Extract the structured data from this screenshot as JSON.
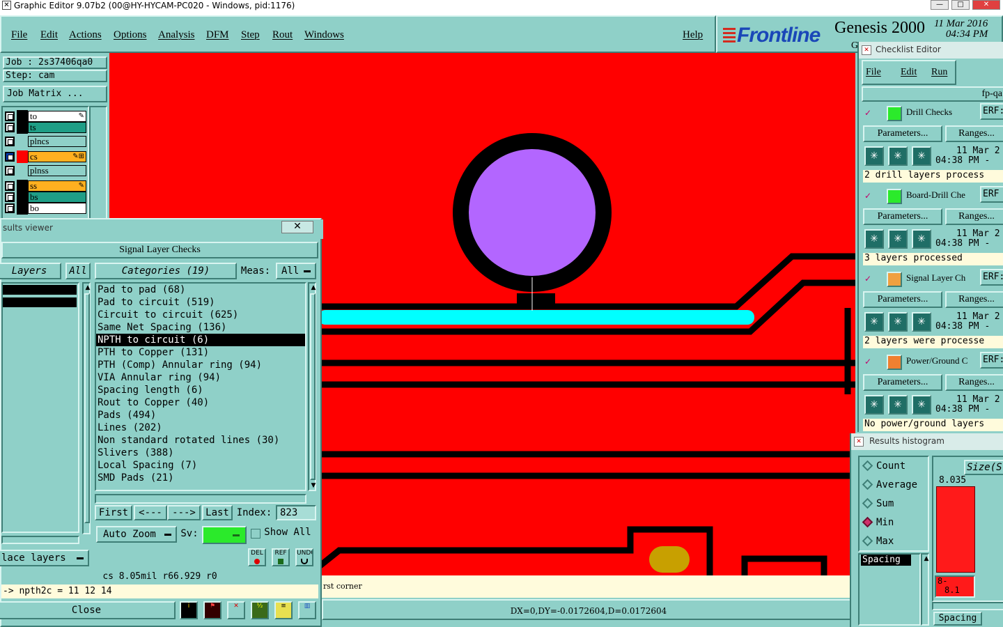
{
  "titlebar": {
    "title": "Graphic Editor 9.07b2 (00@HY-HYCAM-PC020 - Windows, pid:1176)",
    "icon": "x-app-icon",
    "min": "—",
    "max": "□",
    "close": "✕"
  },
  "menu": {
    "items": [
      "File",
      "Edit",
      "Actions",
      "Options",
      "Analysis",
      "DFM",
      "Step",
      "Rout",
      "Windows"
    ],
    "help": "Help"
  },
  "brand": {
    "logo": "Frontline",
    "product": "Genesis 2000",
    "date": "11 Mar 2016",
    "time": "04:34 PM",
    "fragment": "G"
  },
  "left_panel": {
    "job": "Job : 2s37406qa0",
    "step": "Step: cam",
    "job_matrix": "Job Matrix ...",
    "layers": [
      {
        "name": "to",
        "swatch": "#000000",
        "bg": "#ffffff",
        "mark": "✎"
      },
      {
        "name": "ts",
        "swatch": "#000000",
        "bg": "#1f9e86",
        "mark": ""
      },
      {
        "name": "plncs",
        "swatch": "#8fd0c8",
        "bg": "#8fd0c8",
        "mark": ""
      },
      {
        "name": "cs",
        "swatch": "#ff0000",
        "bg": "#ffb020",
        "mark": "✎⊞",
        "selected": true
      },
      {
        "name": "plnss",
        "swatch": "#8fd0c8",
        "bg": "#8fd0c8",
        "mark": ""
      },
      {
        "name": "ss",
        "swatch": "#000000",
        "bg": "#ffb020",
        "mark": "✎"
      },
      {
        "name": "bs",
        "swatch": "#000000",
        "bg": "#1f9e86",
        "mark": ""
      },
      {
        "name": "bo",
        "swatch": "#000000",
        "bg": "#ffffff",
        "mark": ""
      }
    ]
  },
  "results_viewer": {
    "title": "sults viewer",
    "close": "✕",
    "header": "Signal Layer Checks",
    "layers_label": "Layers",
    "layers_all": "All",
    "categories_label": "Categories (19)",
    "meas_label": "Meas:",
    "meas_value": "All",
    "categories": [
      "Pad to pad (68)",
      "Pad to circuit (519)",
      "Circuit to circuit (625)",
      "Same Net Spacing (136)",
      "NPTH to circuit (6)",
      "PTH to Copper (131)",
      "PTH (Comp) Annular ring (94)",
      "VIA Annular ring (94)",
      "Spacing length (6)",
      "Rout to Copper (40)",
      "Pads (494)",
      "Lines (202)",
      "Non standard rotated lines (30)",
      "Slivers (388)",
      "Local Spacing (7)",
      "SMD Pads (21)"
    ],
    "selected_category": 4,
    "first": "First",
    "prev": "<---",
    "next": "--->",
    "last": "Last",
    "index_label": "Index:",
    "index_value": "823",
    "auto_zoom": "Auto Zoom",
    "sv_label": "Sv:",
    "show_all": "Show All",
    "place_layers": "lace layers",
    "del": "DEL",
    "ref": "REF",
    "undo": "UNDO",
    "info": "cs 8.05mil  r66.929  r0",
    "cmd": "-> npth2c = 11 12 14",
    "close_btn": "Close"
  },
  "status": {
    "hint": "rst corner",
    "coords": "DX=0,DY=-0.0172604,D=0.0172604"
  },
  "checklist": {
    "title": "Checklist Editor",
    "menu": [
      "File",
      "Edit",
      "Run"
    ],
    "name": "fp-qa",
    "checks": [
      {
        "name": "Drill Checks",
        "erf": "ERF:",
        "date": "11 Mar 2",
        "time": "04:38 PM -",
        "status": "2 drill layers process",
        "icon": "drill-icon"
      },
      {
        "name": "Board-Drill Che",
        "erf": "ERF",
        "date": "11 Mar 2",
        "time": "04:38 PM -",
        "status": "3 layers processed",
        "icon": "board-drill-icon"
      },
      {
        "name": "Signal Layer Ch",
        "erf": "ERF:",
        "date": "11 Mar 2",
        "time": "04:38 PM -",
        "status": "2 layers were processe",
        "icon": "signal-layer-icon"
      },
      {
        "name": "Power/Ground C",
        "erf": "ERF:",
        "date": "11 Mar 2",
        "time": "04:38 PM -",
        "status": "No power/ground layers",
        "icon": "power-ground-icon"
      }
    ],
    "params": "Parameters...",
    "ranges": "Ranges..."
  },
  "histogram": {
    "title": "Results histogram",
    "options": [
      "Count",
      "Average",
      "Sum",
      "Min",
      "Max"
    ],
    "selected": "Min",
    "size_label": "Size(S",
    "bar_value": "8.035",
    "bar_min_label": "8-",
    "bar_min_value": "8.1",
    "spacing1": "Spacing",
    "spacing2": "Spacing",
    "bar_fill": 1.0
  },
  "colors": {
    "bg": "#8fd0c8",
    "canvas": "#ff0000",
    "highlight": "#00ffff",
    "pad": "#b366ff",
    "copper2": "#c8a000"
  }
}
